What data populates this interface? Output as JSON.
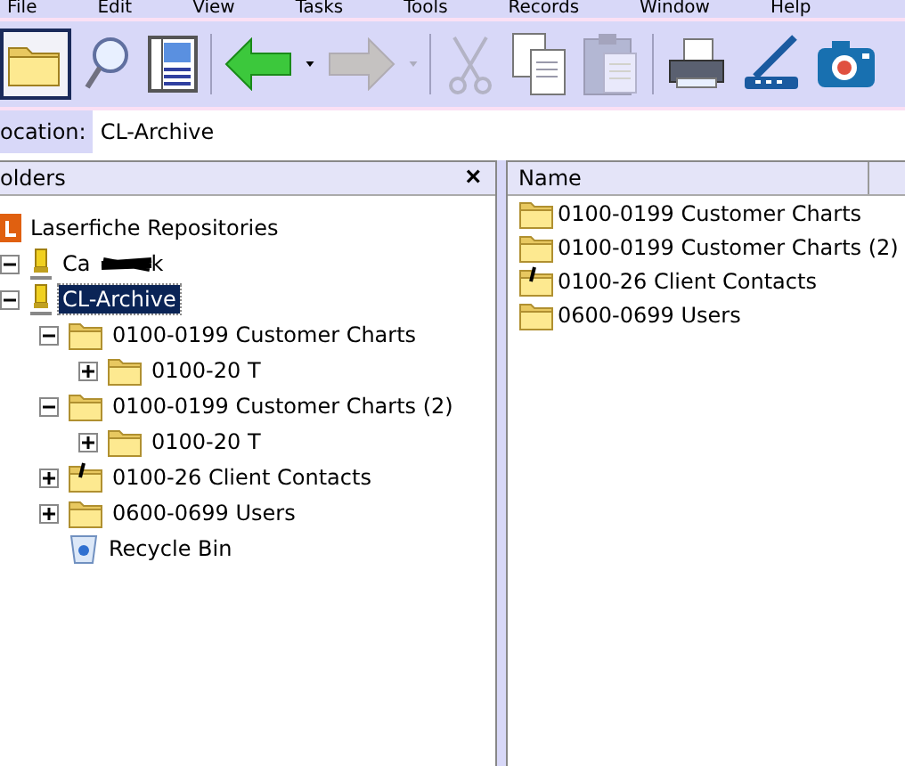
{
  "menu": [
    "File",
    "Edit",
    "View",
    "Tasks",
    "Tools",
    "Records",
    "Window",
    "Help"
  ],
  "toolbar": [
    {
      "kind": "folders",
      "selected": true,
      "disabled": false
    },
    {
      "kind": "search",
      "selected": false,
      "disabled": false
    },
    {
      "kind": "preview",
      "selected": false,
      "disabled": false
    },
    {
      "kind": "back",
      "selected": false,
      "disabled": false
    },
    {
      "kind": "forward",
      "selected": false,
      "disabled": true
    },
    {
      "kind": "cut",
      "selected": false,
      "disabled": true
    },
    {
      "kind": "copy",
      "selected": false,
      "disabled": false
    },
    {
      "kind": "paste",
      "selected": false,
      "disabled": true
    },
    {
      "kind": "print",
      "selected": false,
      "disabled": false
    },
    {
      "kind": "scanner",
      "selected": false,
      "disabled": false
    },
    {
      "kind": "camera",
      "selected": false,
      "disabled": false
    }
  ],
  "location": {
    "label": "ocation:",
    "value": "CL-Archive"
  },
  "folders_panel": {
    "title": "olders",
    "close": "×",
    "tree": [
      {
        "label": "Laserfiche Repositories",
        "kind": "root",
        "selected": false,
        "children": [
          {
            "label": "Ca",
            "label_end": "k",
            "redacted": true,
            "kind": "repository",
            "expanded": true,
            "selected": false
          },
          {
            "label": "CL-Archive",
            "kind": "repository",
            "expanded": true,
            "selected": true,
            "children": [
              {
                "label": "0100-0199 Customer Charts",
                "kind": "folder",
                "expanded": true,
                "selected": false,
                "children": [
                  {
                    "label": "0100-20 T",
                    "kind": "folder",
                    "expanded": false,
                    "selected": false
                  }
                ]
              },
              {
                "label": "0100-0199 Customer Charts (2)",
                "kind": "folder",
                "expanded": true,
                "selected": false,
                "children": [
                  {
                    "label": "0100-20 T",
                    "kind": "folder",
                    "expanded": false,
                    "selected": false
                  }
                ]
              },
              {
                "label": "0100-26 Client Contacts",
                "kind": "marked-folder",
                "expanded": false,
                "selected": false
              },
              {
                "label": "0600-0699 Users",
                "kind": "folder",
                "expanded": false,
                "selected": false
              },
              {
                "label": "Recycle Bin",
                "kind": "recycle-bin",
                "selected": false
              }
            ]
          }
        ]
      }
    ]
  },
  "list": {
    "columns": [
      "Name"
    ],
    "rows": [
      {
        "name": "0100-0199 Customer Charts",
        "kind": "folder"
      },
      {
        "name": "0100-0199 Customer Charts (2)",
        "kind": "folder"
      },
      {
        "name": "0100-26 Client Contacts",
        "kind": "marked-folder"
      },
      {
        "name": "0600-0699 Users",
        "kind": "folder"
      }
    ]
  }
}
